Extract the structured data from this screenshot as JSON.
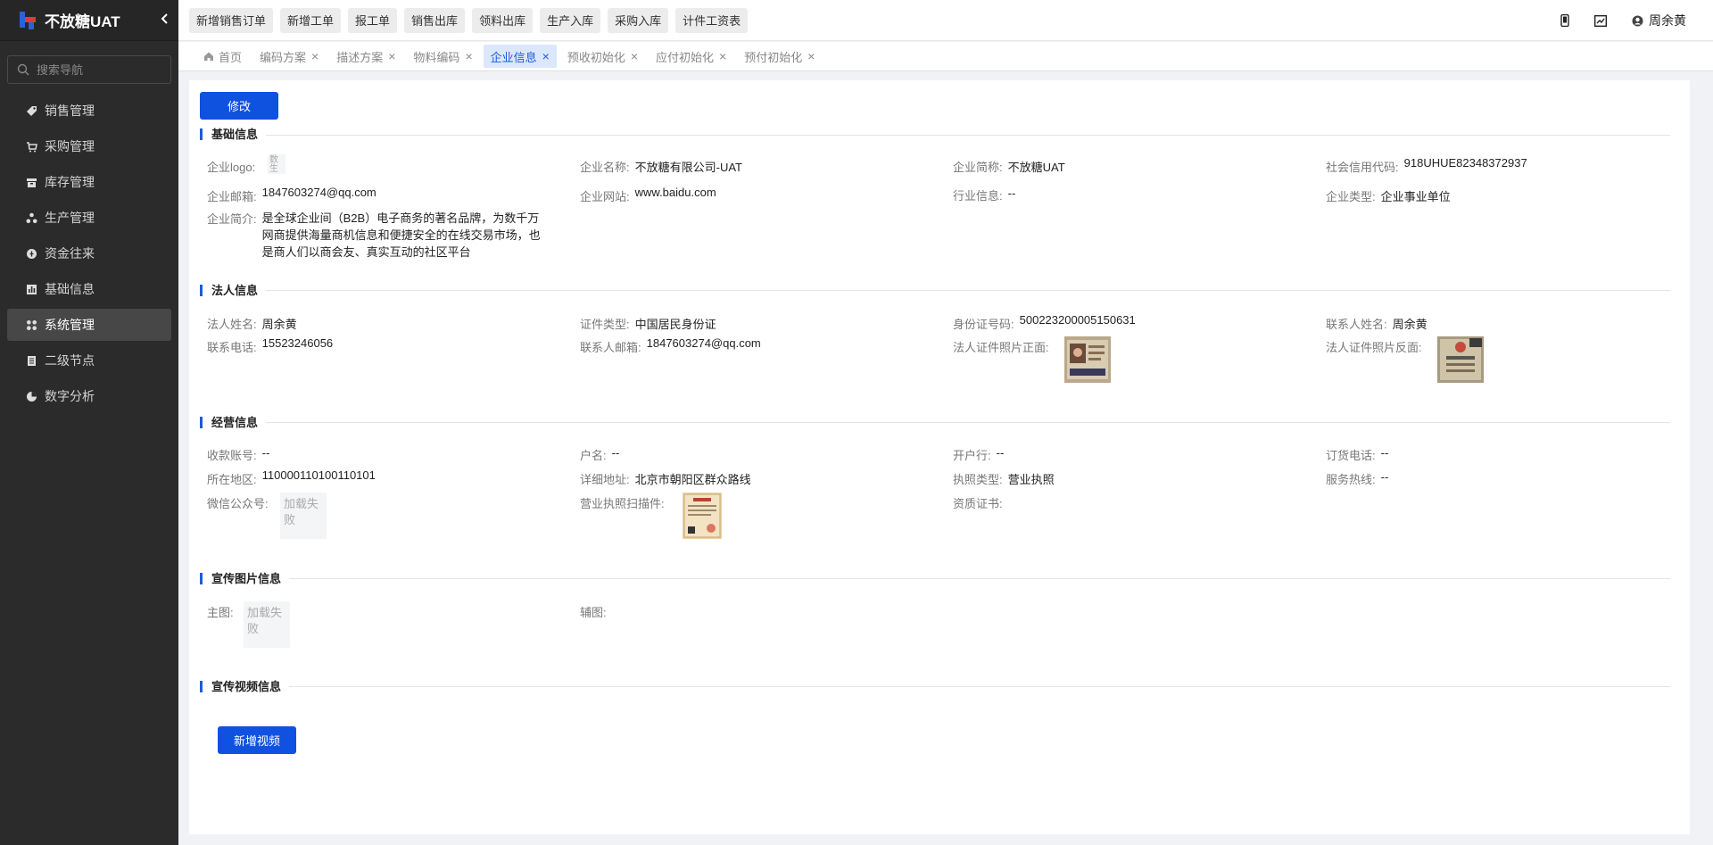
{
  "brand": {
    "title": "不放糖UAT"
  },
  "sidebar": {
    "search_placeholder": "搜索导航",
    "items": [
      {
        "label": "销售管理",
        "icon": "tag-icon"
      },
      {
        "label": "采购管理",
        "icon": "cart-icon"
      },
      {
        "label": "库存管理",
        "icon": "box-icon"
      },
      {
        "label": "生产管理",
        "icon": "nodes-icon"
      },
      {
        "label": "资金往来",
        "icon": "coin-icon"
      },
      {
        "label": "基础信息",
        "icon": "chart-icon"
      },
      {
        "label": "系统管理",
        "icon": "grid-icon",
        "active": true
      },
      {
        "label": "二级节点",
        "icon": "doc-icon"
      },
      {
        "label": "数字分析",
        "icon": "pie-icon"
      }
    ]
  },
  "topbar": {
    "quick_buttons": [
      "新增销售订单",
      "新增工单",
      "报工单",
      "销售出库",
      "领料出库",
      "生产入库",
      "采购入库",
      "计件工资表"
    ],
    "user_name": "周余黄"
  },
  "tabs": [
    {
      "label": "首页",
      "home": true
    },
    {
      "label": "编码方案"
    },
    {
      "label": "描述方案"
    },
    {
      "label": "物料编码"
    },
    {
      "label": "企业信息",
      "active": true
    },
    {
      "label": "预收初始化"
    },
    {
      "label": "应付初始化"
    },
    {
      "label": "预付初始化"
    }
  ],
  "content": {
    "edit_button": "修改",
    "add_video_button": "新增视频",
    "sections": {
      "basic": "基础信息",
      "legal": "法人信息",
      "business": "经营信息",
      "promo_images": "宣传图片信息",
      "promo_video": "宣传视频信息"
    },
    "basic": {
      "logo_label": "企业logo:",
      "logo_alt": "数\n生",
      "name_label": "企业名称:",
      "name": "不放糖有限公司-UAT",
      "short_label": "企业简称:",
      "short": "不放糖UAT",
      "credit_label": "社会信用代码:",
      "credit": "918UHUE82348372937",
      "email_label": "企业邮箱:",
      "email": "1847603274@qq.com",
      "website_label": "企业网站:",
      "website": "www.baidu.com",
      "industry_label": "行业信息:",
      "industry": "--",
      "type_label": "企业类型:",
      "type": "企业事业单位",
      "intro_label": "企业简介:",
      "intro": "是全球企业间（B2B）电子商务的著名品牌，为数千万网商提供海量商机信息和便捷安全的在线交易市场，也是商人们以商会友、真实互动的社区平台"
    },
    "legal": {
      "name_label": "法人姓名:",
      "name": "周余黄",
      "idtype_label": "证件类型:",
      "idtype": "中国居民身份证",
      "idno_label": "身份证号码:",
      "idno": "500223200005150631",
      "contact_label": "联系人姓名:",
      "contact": "周余黄",
      "phone_label": "联系电话:",
      "phone": "15523246056",
      "cemail_label": "联系人邮箱:",
      "cemail": "1847603274@qq.com",
      "front_label": "法人证件照片正面:",
      "back_label": "法人证件照片反面:"
    },
    "business": {
      "account_label": "收款账号:",
      "account": "--",
      "holder_label": "户名:",
      "holder": "--",
      "bank_label": "开户行:",
      "bank": "--",
      "order_phone_label": "订货电话:",
      "order_phone": "--",
      "region_label": "所在地区:",
      "region": "110000110100110101",
      "address_label": "详细地址:",
      "address": "北京市朝阳区群众路线",
      "license_type_label": "执照类型:",
      "license_type": "营业执照",
      "hotline_label": "服务热线:",
      "hotline": "--",
      "wechat_label": "微信公众号:",
      "wechat_fail": "加载失败",
      "scan_label": "营业执照扫描件:",
      "cert_label": "资质证书:"
    },
    "promo": {
      "main_label": "主图:",
      "main_fail": "加载失败",
      "sub_label": "辅图:"
    }
  },
  "colors": {
    "primary": "#1052e0",
    "sidebar": "#2b2b2b",
    "active_tab_bg": "#dbe7fb"
  }
}
